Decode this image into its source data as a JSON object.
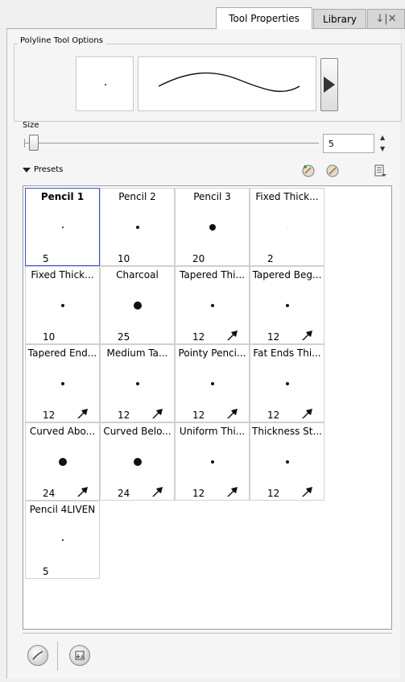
{
  "tabs": {
    "tool_properties": "Tool Properties",
    "library": "Library",
    "controls": "↓|✕"
  },
  "options": {
    "group_label": "Polyline Tool Options",
    "size_label": "Size",
    "size_value": "5",
    "spin_up": "▲",
    "spin_down": "▼"
  },
  "presets": {
    "label": "Presets",
    "icons": [
      "new-preset-icon",
      "rename-preset-icon",
      "presets-menu-icon"
    ],
    "selected": "Pencil 1",
    "items": [
      {
        "name": "Pencil 1",
        "size": "5",
        "dot": 2,
        "tapered": false
      },
      {
        "name": "Pencil 2",
        "size": "10",
        "dot": 4,
        "tapered": false
      },
      {
        "name": "Pencil 3",
        "size": "20",
        "dot": 8,
        "tapered": false
      },
      {
        "name": "Fixed Thick...",
        "size": "2",
        "dot": 1,
        "tapered": false
      },
      {
        "name": "Fixed Thick...",
        "size": "10",
        "dot": 4,
        "tapered": false
      },
      {
        "name": "Charcoal",
        "size": "25",
        "dot": 10,
        "tapered": false
      },
      {
        "name": "Tapered Thi...",
        "size": "12",
        "dot": 4,
        "tapered": true
      },
      {
        "name": "Tapered Beg...",
        "size": "12",
        "dot": 4,
        "tapered": true
      },
      {
        "name": "Tapered End...",
        "size": "12",
        "dot": 4,
        "tapered": true
      },
      {
        "name": "Medium Ta...",
        "size": "12",
        "dot": 4,
        "tapered": true
      },
      {
        "name": "Pointy Penci...",
        "size": "12",
        "dot": 4,
        "tapered": true
      },
      {
        "name": "Fat Ends Thi...",
        "size": "12",
        "dot": 4,
        "tapered": true
      },
      {
        "name": "Curved Abo...",
        "size": "24",
        "dot": 10,
        "tapered": true
      },
      {
        "name": "Curved Belo...",
        "size": "24",
        "dot": 10,
        "tapered": true
      },
      {
        "name": "Uniform Thi...",
        "size": "12",
        "dot": 4,
        "tapered": true
      },
      {
        "name": "Thickness St...",
        "size": "12",
        "dot": 4,
        "tapered": true
      },
      {
        "name": "Pencil 4LIVEN",
        "size": "5",
        "dot": 2,
        "tapered": false
      }
    ]
  },
  "bottom_icons": [
    "brush-stroke-icon",
    "import-preset-icon"
  ]
}
